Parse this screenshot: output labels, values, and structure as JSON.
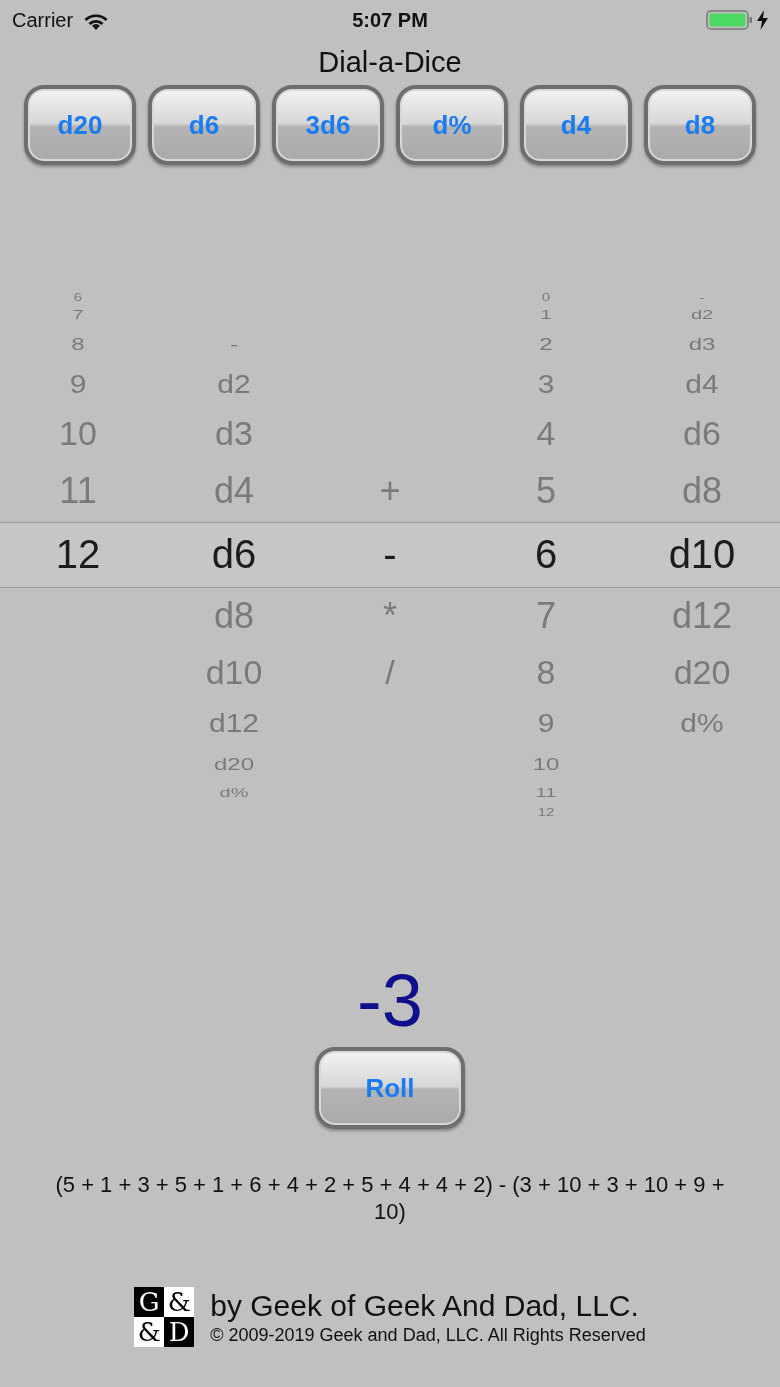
{
  "status_bar": {
    "carrier": "Carrier",
    "time": "5:07 PM"
  },
  "title": "Dial-a-Dice",
  "quick_buttons": [
    "d20",
    "d6",
    "3d6",
    "d%",
    "d4",
    "d8"
  ],
  "picker": {
    "columns": [
      {
        "items": [
          {
            "label": "6",
            "selected": false
          },
          {
            "label": "7",
            "selected": false
          },
          {
            "label": "8",
            "selected": false
          },
          {
            "label": "9",
            "selected": false
          },
          {
            "label": "10",
            "selected": false
          },
          {
            "label": "11",
            "selected": false
          },
          {
            "label": "12",
            "selected": true
          }
        ]
      },
      {
        "items": [
          {
            "label": "-",
            "selected": false
          },
          {
            "label": "d2",
            "selected": false
          },
          {
            "label": "d3",
            "selected": false
          },
          {
            "label": "d4",
            "selected": false
          },
          {
            "label": "d6",
            "selected": true
          },
          {
            "label": "d8",
            "selected": false
          },
          {
            "label": "d10",
            "selected": false
          },
          {
            "label": "d12",
            "selected": false
          },
          {
            "label": "d20",
            "selected": false
          },
          {
            "label": "d%",
            "selected": false
          }
        ]
      },
      {
        "items": [
          {
            "label": "+",
            "selected": false
          },
          {
            "label": "-",
            "selected": true
          },
          {
            "label": "*",
            "selected": false
          },
          {
            "label": "/",
            "selected": false
          }
        ]
      },
      {
        "items": [
          {
            "label": "0",
            "selected": false
          },
          {
            "label": "1",
            "selected": false
          },
          {
            "label": "2",
            "selected": false
          },
          {
            "label": "3",
            "selected": false
          },
          {
            "label": "4",
            "selected": false
          },
          {
            "label": "5",
            "selected": false
          },
          {
            "label": "6",
            "selected": true
          },
          {
            "label": "7",
            "selected": false
          },
          {
            "label": "8",
            "selected": false
          },
          {
            "label": "9",
            "selected": false
          },
          {
            "label": "10",
            "selected": false
          },
          {
            "label": "11",
            "selected": false
          },
          {
            "label": "12",
            "selected": false
          }
        ]
      },
      {
        "items": [
          {
            "label": "-",
            "selected": false
          },
          {
            "label": "d2",
            "selected": false
          },
          {
            "label": "d3",
            "selected": false
          },
          {
            "label": "d4",
            "selected": false
          },
          {
            "label": "d6",
            "selected": false
          },
          {
            "label": "d8",
            "selected": false
          },
          {
            "label": "d10",
            "selected": true
          },
          {
            "label": "d12",
            "selected": false
          },
          {
            "label": "d20",
            "selected": false
          },
          {
            "label": "d%",
            "selected": false
          }
        ]
      }
    ]
  },
  "result": "-3",
  "roll_button": "Roll",
  "breakdown": "(5 + 1 + 3 + 5 + 1 + 6 + 4 + 2 + 5 + 4 + 4 + 2) - (3 + 10 + 3 + 10 + 9 + 10)",
  "footer": {
    "logo": [
      "G",
      "&",
      "&",
      "D"
    ],
    "byline": "by Geek of Geek And Dad, LLC.",
    "copyright": "© 2009-2019 Geek and Dad, LLC. All Rights Reserved"
  }
}
